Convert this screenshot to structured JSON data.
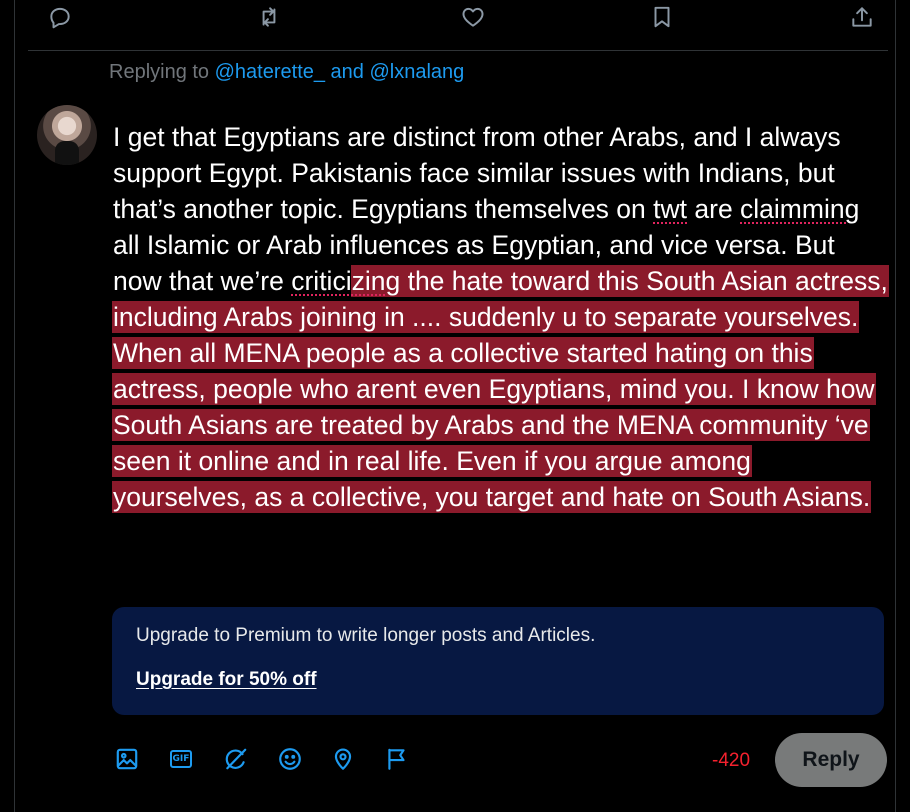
{
  "replying": {
    "prefix": "Replying to ",
    "mention1": "@haterette_",
    "conjunction": " and ",
    "mention2": "@lxnalang"
  },
  "composer": {
    "seg1": "I get that Egyptians are distinct from other Arabs, and I always support Egypt. Pakistanis face similar issues with Indians, but that’s another topic. Egyptians themselves on ",
    "spell1": "twt",
    "seg2": " are ",
    "spell2": "claimming",
    "seg3": " all Islamic or Arab influences as Egyptian, and vice versa. But now that we’re ",
    "spell3": "critici",
    "overflow_spell": "zing",
    "overflow": " the hate toward this South Asian actress, including Arabs joining in .... suddenly u to separate yourselves. When all MENA people as a collective started hating on this actress, people who arent even Egyptians, mind you. I know how South Asians are treated by Arabs and the MENA community ‘ve seen it online and in real life. Even if you argue among yourselves, as a collective, you target and hate on South Asians."
  },
  "premium": {
    "message": "Upgrade to Premium to write longer posts and Articles.",
    "cta": "Upgrade for 50% off",
    "background": "#071842"
  },
  "toolbar": {
    "gif_label": "GIF",
    "counter": "-420",
    "reply_label": "Reply"
  },
  "colors": {
    "accent": "#1d9bf0",
    "overflow_highlight": "#8b1a2b",
    "counter": "#f4212e"
  },
  "icons": {
    "action_bar": [
      "reply-icon",
      "repost-icon",
      "like-icon",
      "bookmark-icon",
      "share-icon"
    ],
    "toolbar": [
      "media-icon",
      "gif-icon",
      "grok-icon",
      "emoji-icon",
      "location-icon",
      "flag-icon"
    ]
  }
}
